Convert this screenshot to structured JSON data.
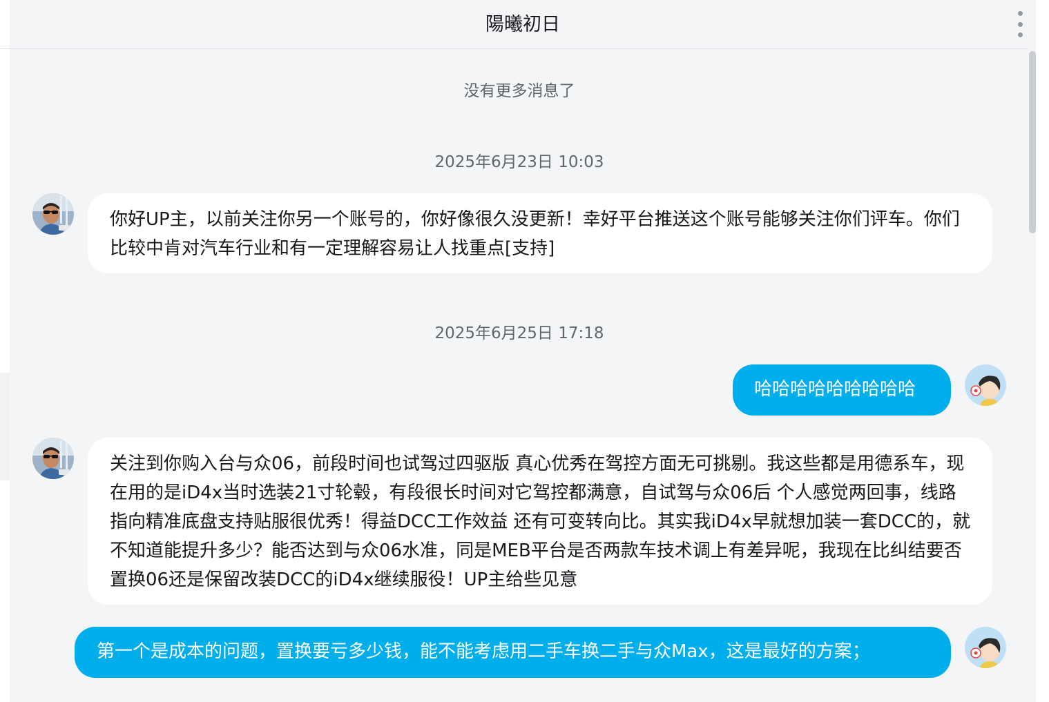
{
  "header": {
    "title": "陽曦初日"
  },
  "status": {
    "no_more": "没有更多消息了"
  },
  "messages": [
    {
      "type": "timestamp",
      "text": "2025年6月23日 10:03"
    },
    {
      "type": "incoming",
      "text": "你好UP主，以前关注你另一个账号的，你好像很久没更新！幸好平台推送这个账号能够关注你们评车。你们比较中肯对汽车行业和有一定理解容易让人找重点[支持]"
    },
    {
      "type": "timestamp",
      "text": "2025年6月25日 17:18"
    },
    {
      "type": "outgoing",
      "text": "哈哈哈哈哈哈哈哈哈"
    },
    {
      "type": "incoming",
      "text": "关注到你购入台与众06，前段时间也试驾过四驱版 真心优秀在驾控方面无可挑剔。我这些都是用德系车，现在用的是iD4x当时选装21寸轮毂，有段很长时间对它驾控都满意，自试驾与众06后 个人感觉两回事，线路指向精准底盘支持贴服很优秀！得益DCC工作效益 还有可变转向比。其实我iD4x早就想加装一套DCC的，就不知道能提升多少？能否达到与众06水准，同是MEB平台是否两款车技术调上有差异呢，我现在比纠结要否置换06还是保留改装DCC的iD4x继续服役！UP主给些见意"
    },
    {
      "type": "outgoing",
      "text": "第一个是成本的问题，置换要亏多少钱，能不能考虑用二手车换二手与众Max，这是最好的方案；"
    }
  ],
  "colors": {
    "outgoing_bubble": "#00aeec",
    "incoming_bubble": "#ffffff",
    "background": "#f4f5f7"
  },
  "icons": {
    "more": "more-vertical-icon"
  }
}
